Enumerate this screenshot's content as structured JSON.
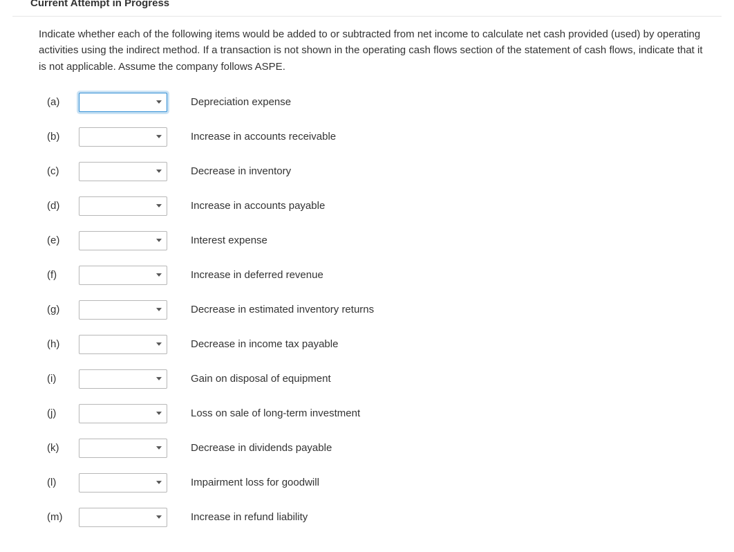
{
  "header": {
    "title": "Current Attempt in Progress"
  },
  "instructions": "Indicate whether each of the following items would be added to or subtracted from net income to calculate net cash provided (used) by operating activities using the indirect method. If a transaction is not shown in the operating cash flows section of the statement of cash flows, indicate that it is not applicable. Assume the company follows ASPE.",
  "items": [
    {
      "label": "(a)",
      "desc": "Depreciation expense",
      "value": "",
      "focused": true
    },
    {
      "label": "(b)",
      "desc": "Increase in accounts receivable",
      "value": "",
      "focused": false
    },
    {
      "label": "(c)",
      "desc": "Decrease in inventory",
      "value": "",
      "focused": false
    },
    {
      "label": "(d)",
      "desc": "Increase in accounts payable",
      "value": "",
      "focused": false
    },
    {
      "label": "(e)",
      "desc": "Interest expense",
      "value": "",
      "focused": false
    },
    {
      "label": "(f)",
      "desc": "Increase in deferred revenue",
      "value": "",
      "focused": false
    },
    {
      "label": "(g)",
      "desc": "Decrease in estimated inventory returns",
      "value": "",
      "focused": false
    },
    {
      "label": "(h)",
      "desc": "Decrease in income tax payable",
      "value": "",
      "focused": false
    },
    {
      "label": "(i)",
      "desc": "Gain on disposal of equipment",
      "value": "",
      "focused": false
    },
    {
      "label": "(j)",
      "desc": "Loss on sale of long-term investment",
      "value": "",
      "focused": false
    },
    {
      "label": "(k)",
      "desc": "Decrease in dividends payable",
      "value": "",
      "focused": false
    },
    {
      "label": "(l)",
      "desc": "Impairment loss for goodwill",
      "value": "",
      "focused": false
    },
    {
      "label": "(m)",
      "desc": "Increase in refund liability",
      "value": "",
      "focused": false
    }
  ]
}
